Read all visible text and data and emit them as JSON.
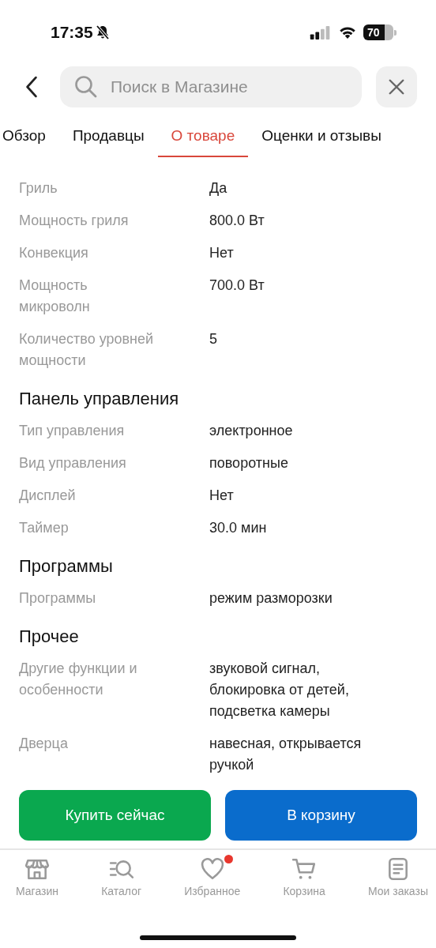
{
  "status_bar": {
    "time": "17:35",
    "battery": "70"
  },
  "search": {
    "placeholder": "Поиск в Магазине"
  },
  "tabs": [
    {
      "label": "Обзор",
      "selected": false
    },
    {
      "label": "Продавцы",
      "selected": false
    },
    {
      "label": "О товаре",
      "selected": true
    },
    {
      "label": "Оценки и отзывы",
      "selected": false
    }
  ],
  "sections": [
    {
      "rows": [
        {
          "label": "Гриль",
          "value": "Да"
        },
        {
          "label": "Мощность гриля",
          "value": "800.0 Вт"
        },
        {
          "label": "Конвекция",
          "value": "Нет"
        },
        {
          "label": "Мощность\nмикроволн",
          "value": "700.0 Вт"
        },
        {
          "label": "Количество уровней\nмощности",
          "value": "5"
        }
      ]
    },
    {
      "title": "Панель управления",
      "rows": [
        {
          "label": "Тип управления",
          "value": "электронное"
        },
        {
          "label": "Вид управления",
          "value": "поворотные"
        },
        {
          "label": "Дисплей",
          "value": "Нет"
        },
        {
          "label": "Таймер",
          "value": "30.0 мин"
        }
      ]
    },
    {
      "title": "Программы",
      "rows": [
        {
          "label": "Программы",
          "value": "режим разморозки"
        }
      ]
    },
    {
      "title": "Прочее",
      "rows": [
        {
          "label": "Другие функции и\nособенности",
          "value": "звуковой сигнал,\nблокировка от детей,\nподсветка камеры"
        },
        {
          "label": "Дверца",
          "value": "навесная, открывается\nручкой"
        }
      ]
    }
  ],
  "buttons": [
    {
      "label": "Купить сейчас",
      "kind": "buy"
    },
    {
      "label": "В корзину",
      "kind": "cart"
    }
  ],
  "nav": [
    {
      "label": "Магазин",
      "kind": "store",
      "notification": false
    },
    {
      "label": "Каталог",
      "kind": "catalog",
      "notification": false
    },
    {
      "label": "Избранное",
      "kind": "favorites",
      "notification": true
    },
    {
      "label": "Корзина",
      "kind": "cart",
      "notification": false
    },
    {
      "label": "Мои заказы",
      "kind": "orders",
      "notification": false
    }
  ]
}
